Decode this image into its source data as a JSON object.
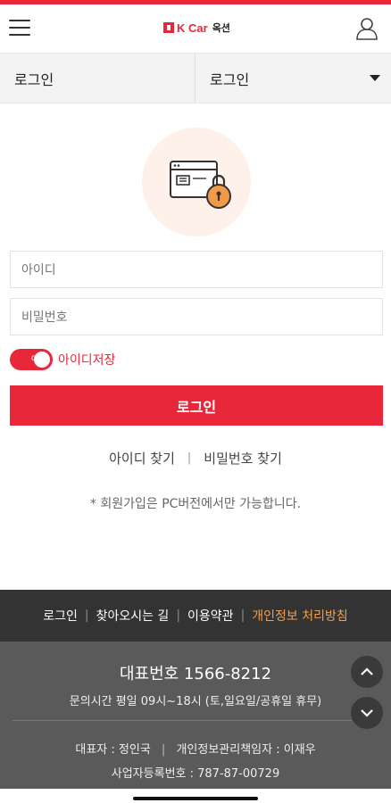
{
  "header": {
    "logo_brand": "K Car",
    "logo_sub": "옥션",
    "menu_icon": "hamburger-menu-icon",
    "user_icon": "user-profile-icon"
  },
  "nav": {
    "left_label": "로그인",
    "right_label": "로그인",
    "right_icon": "caret-down-icon"
  },
  "illustration": {
    "icon": "browser-lock-icon"
  },
  "form": {
    "id_placeholder": "아이디",
    "pw_placeholder": "비밀번호",
    "toggle_text": "on",
    "save_id_label": "아이디저장",
    "login_button": "로그인"
  },
  "links": {
    "find_id": "아이디 찾기",
    "separator": "|",
    "find_pw": "비밀번호 찾기"
  },
  "notice": "* 회원가입은 PC버전에서만 가능합니다.",
  "footer_nav": {
    "items": [
      "로그인",
      "찾아오시는 길",
      "이용약관",
      "개인정보 처리방침"
    ],
    "separator": "|"
  },
  "footer_info": {
    "rep_phone": "대표번호 1566-8212",
    "hours": "문의시간 평일 09시~18시 (토,일요일/공휴일 휴무)",
    "ceo": "대표자 : 정인국",
    "privacy_officer": "개인정보관리책임자 : 이재우",
    "ceo_separator": "|",
    "business_no": "사업자등록번호 : 787-87-00729"
  },
  "colors": {
    "brand": "#e8283a",
    "footer_highlight": "#f0a04b"
  }
}
